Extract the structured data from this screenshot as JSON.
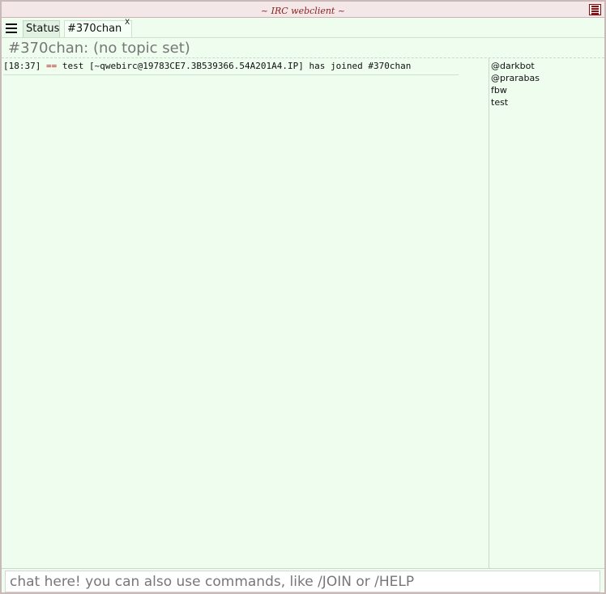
{
  "window": {
    "title": "~ IRC webclient ~",
    "menu_icon": "hamburger-menu-icon"
  },
  "tabs": [
    {
      "label": "Status",
      "active": false
    },
    {
      "label": "#370chan",
      "active": true,
      "close_label": "X"
    }
  ],
  "channel": {
    "topic": "#370chan: (no topic set)"
  },
  "messages": [
    {
      "time": "[18:37]",
      "marker": "==",
      "text": "test [~qwebirc@19783CE7.3B539366.54A201A4.IP] has joined #370chan"
    }
  ],
  "nicklist": [
    "@darkbot",
    "@prarabas",
    "fbw",
    "test"
  ],
  "input": {
    "value": "",
    "placeholder": "chat here! you can also use commands, like /JOIN or /HELP"
  },
  "colors": {
    "background": "#eefdee",
    "title": "#8a1f1f",
    "join_marker": "#d21f1f"
  }
}
